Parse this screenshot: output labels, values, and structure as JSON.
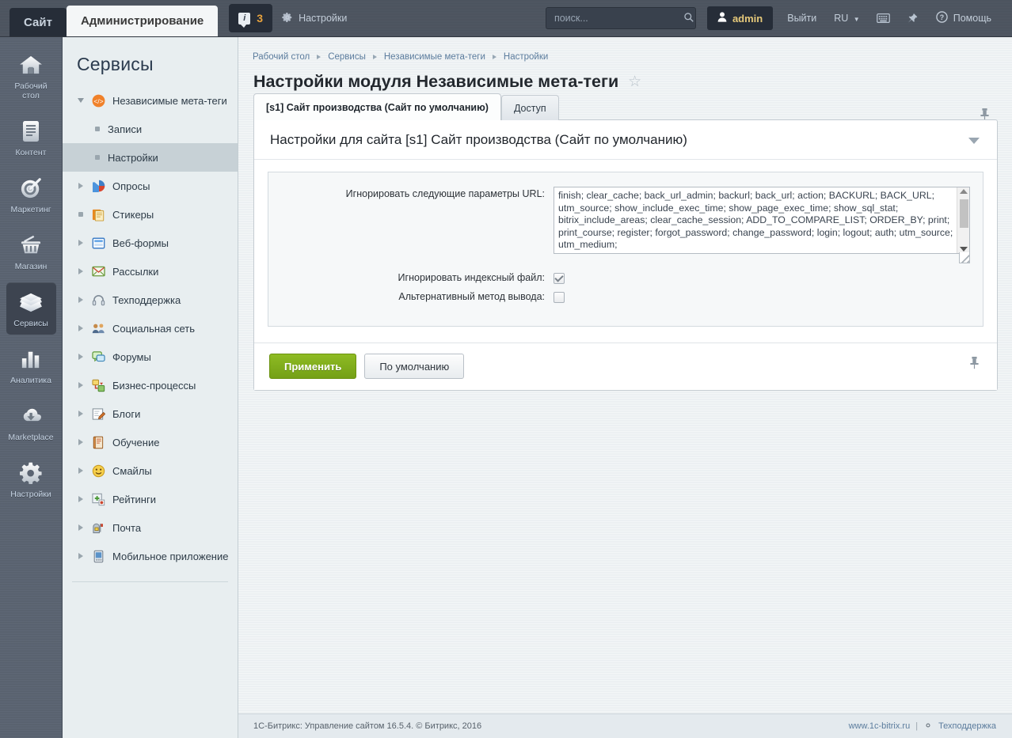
{
  "topbar": {
    "site_tab": "Сайт",
    "admin_tab": "Администрирование",
    "notify_count": "3",
    "settings_link": "Настройки",
    "search_placeholder": "поиск...",
    "search_value": "",
    "user": "admin",
    "logout": "Выйти",
    "lang": "RU",
    "help": "Помощь"
  },
  "rail": {
    "items": [
      {
        "label": "Рабочий стол",
        "icon": "home-icon",
        "active": false
      },
      {
        "label": "Контент",
        "icon": "document-icon",
        "active": false
      },
      {
        "label": "Маркетинг",
        "icon": "target-icon",
        "active": false
      },
      {
        "label": "Магазин",
        "icon": "basket-icon",
        "active": false
      },
      {
        "label": "Сервисы",
        "icon": "layers-icon",
        "active": true
      },
      {
        "label": "Аналитика",
        "icon": "bar-chart-icon",
        "active": false
      },
      {
        "label": "Marketplace",
        "icon": "cloud-download-icon",
        "active": false
      },
      {
        "label": "Настройки",
        "icon": "gear-icon",
        "active": false
      }
    ]
  },
  "menu": {
    "title": "Сервисы",
    "items": [
      {
        "label": "Независимые мета-теги",
        "marker": "arrow-d",
        "icon": "code-tag-icon",
        "selected": false,
        "sub": false
      },
      {
        "label": "Записи",
        "marker": "dot",
        "icon": "none",
        "selected": false,
        "sub": true
      },
      {
        "label": "Настройки",
        "marker": "dot",
        "icon": "none",
        "selected": true,
        "sub": true
      },
      {
        "label": "Опросы",
        "marker": "arrow-r",
        "icon": "pie-chart-icon",
        "selected": false,
        "sub": false
      },
      {
        "label": "Стикеры",
        "marker": "dot",
        "icon": "sticker-icon",
        "selected": false,
        "sub": false
      },
      {
        "label": "Веб-формы",
        "marker": "arrow-r",
        "icon": "web-form-icon",
        "selected": false,
        "sub": false
      },
      {
        "label": "Рассылки",
        "marker": "arrow-r",
        "icon": "envelope-icon",
        "selected": false,
        "sub": false
      },
      {
        "label": "Техподдержка",
        "marker": "arrow-r",
        "icon": "headset-icon",
        "selected": false,
        "sub": false
      },
      {
        "label": "Социальная сеть",
        "marker": "arrow-r",
        "icon": "people-icon",
        "selected": false,
        "sub": false
      },
      {
        "label": "Форумы",
        "marker": "arrow-r",
        "icon": "chat-bubbles-icon",
        "selected": false,
        "sub": false
      },
      {
        "label": "Бизнес-процессы",
        "marker": "arrow-r",
        "icon": "workflow-icon",
        "selected": false,
        "sub": false
      },
      {
        "label": "Блоги",
        "marker": "arrow-r",
        "icon": "pencil-note-icon",
        "selected": false,
        "sub": false
      },
      {
        "label": "Обучение",
        "marker": "arrow-r",
        "icon": "book-icon",
        "selected": false,
        "sub": false
      },
      {
        "label": "Смайлы",
        "marker": "arrow-r",
        "icon": "smiley-icon",
        "selected": false,
        "sub": false
      },
      {
        "label": "Рейтинги",
        "marker": "arrow-r",
        "icon": "plus-badge-icon",
        "selected": false,
        "sub": false
      },
      {
        "label": "Почта",
        "marker": "arrow-r",
        "icon": "mailbox-icon",
        "selected": false,
        "sub": false
      },
      {
        "label": "Мобильное приложение",
        "marker": "arrow-r",
        "icon": "mobile-icon",
        "selected": false,
        "sub": false
      }
    ]
  },
  "breadcrumb": [
    "Рабочий стол",
    "Сервисы",
    "Независимые мета-теги",
    "Настройки"
  ],
  "page": {
    "title": "Настройки модуля Независимые мета-теги",
    "star": "☆"
  },
  "tabs": [
    {
      "label": "[s1] Сайт производства (Сайт по умолчанию)",
      "active": true
    },
    {
      "label": "Доступ",
      "active": false
    }
  ],
  "card": {
    "heading": "Настройки для сайта [s1] Сайт производства (Сайт по умолчанию)",
    "fields": {
      "url_params_label": "Игнорировать следующие параметры URL:",
      "url_params_value": "finish; clear_cache; back_url_admin; backurl; back_url; action; BACKURL; BACK_URL; utm_source; show_include_exec_time; show_page_exec_time; show_sql_stat; bitrix_include_areas; clear_cache_session; ADD_TO_COMPARE_LIST; ORDER_BY; print; print_course; register; forgot_password; change_password; login; logout; auth; utm_source; utm_medium;",
      "ignore_index_label": "Игнорировать индексный файл:",
      "ignore_index_checked": true,
      "alt_output_label": "Альтернативный метод вывода:",
      "alt_output_checked": false
    },
    "buttons": {
      "apply": "Применить",
      "default": "По умолчанию"
    }
  },
  "footer": {
    "left": "1С-Битрикс: Управление сайтом 16.5.4. © Битрикс, 2016",
    "site_link": "www.1c-bitrix.ru",
    "separator": "|",
    "support": "Техподдержка"
  },
  "colors": {
    "topbar_bg": "#4c545f",
    "rail_bg": "#5b6472",
    "menu_bg": "#e8eef0",
    "accent_green": "#8ebb23",
    "link_blue": "#5b7c9d",
    "badge_orange": "#e8a33d"
  }
}
